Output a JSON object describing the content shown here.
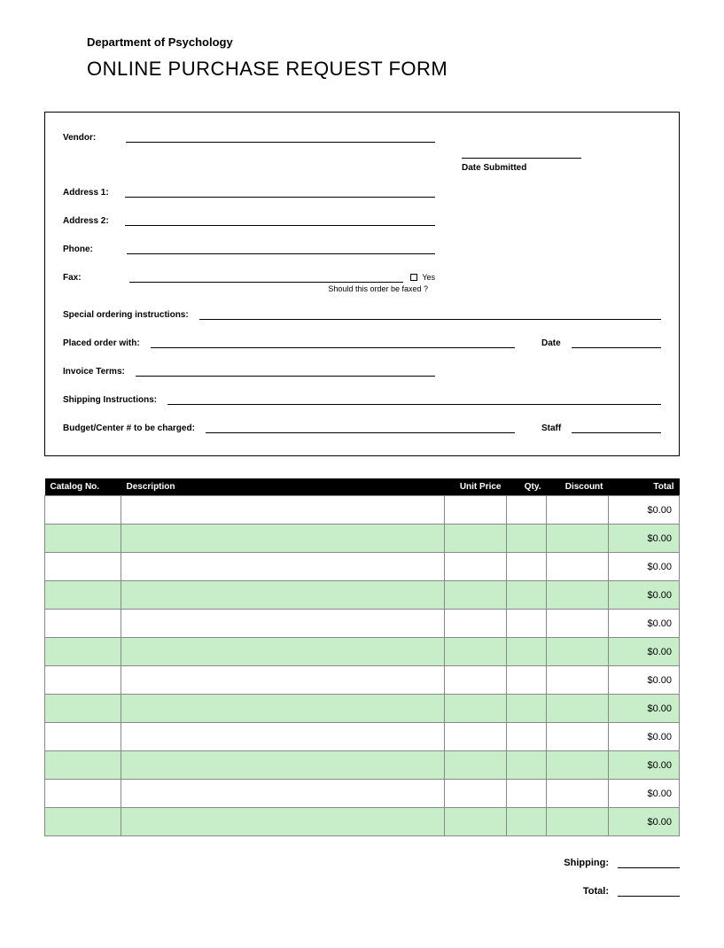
{
  "header": {
    "department": "Department of Psychology",
    "title": "ONLINE PURCHASE REQUEST FORM"
  },
  "form": {
    "vendor_label": "Vendor:",
    "address1_label": "Address 1:",
    "address2_label": "Address 2:",
    "phone_label": "Phone:",
    "fax_label": "Fax:",
    "fax_yes": "Yes",
    "fax_question": "Should this order be faxed ?",
    "date_submitted_label": "Date Submitted",
    "special_label": "Special ordering instructions:",
    "placed_with_label": "Placed order with:",
    "date_label": "Date",
    "invoice_terms_label": "Invoice Terms:",
    "shipping_instr_label": "Shipping Instructions:",
    "budget_label": "Budget/Center # to be charged:",
    "staff_label": "Staff"
  },
  "table": {
    "headers": {
      "catalog": "Catalog No.",
      "description": "Description",
      "unit_price": "Unit Price",
      "qty": "Qty.",
      "discount": "Discount",
      "total": "Total"
    },
    "rows": [
      {
        "total": "$0.00"
      },
      {
        "total": "$0.00"
      },
      {
        "total": "$0.00"
      },
      {
        "total": "$0.00"
      },
      {
        "total": "$0.00"
      },
      {
        "total": "$0.00"
      },
      {
        "total": "$0.00"
      },
      {
        "total": "$0.00"
      },
      {
        "total": "$0.00"
      },
      {
        "total": "$0.00"
      },
      {
        "total": "$0.00"
      },
      {
        "total": "$0.00"
      }
    ]
  },
  "footer": {
    "shipping_label": "Shipping:",
    "total_label": "Total:"
  }
}
